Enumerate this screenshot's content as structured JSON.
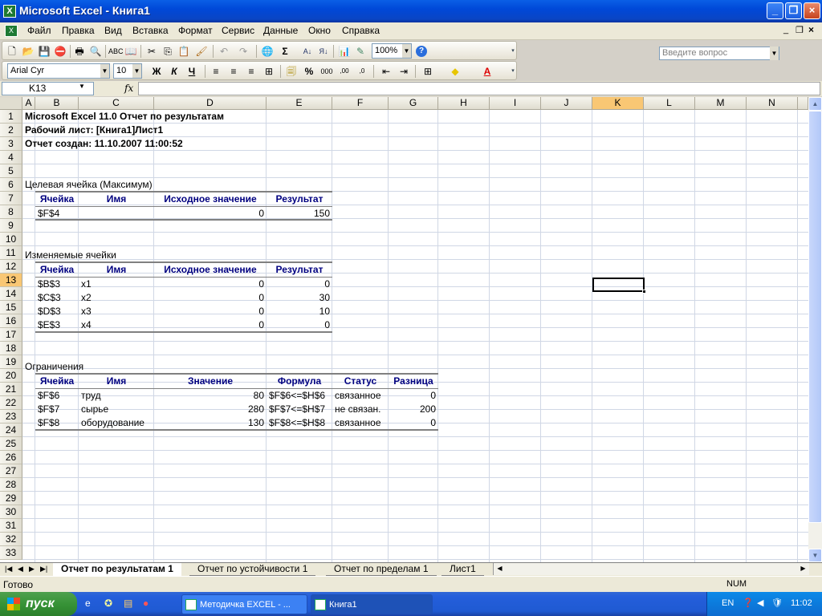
{
  "window": {
    "title": "Microsoft Excel - Книга1",
    "app_icon": "excel-icon"
  },
  "menu": {
    "items": [
      "Файл",
      "Правка",
      "Вид",
      "Вставка",
      "Формат",
      "Сервис",
      "Данные",
      "Окно",
      "Справка"
    ],
    "ask_placeholder": "Введите вопрос"
  },
  "toolbar": {
    "zoom": "100%",
    "font": "Arial Cyr",
    "size": "10"
  },
  "formula_bar": {
    "name_box": "K13",
    "fx_label": "fx",
    "content": ""
  },
  "columns": [
    "A",
    "B",
    "C",
    "D",
    "E",
    "F",
    "G",
    "H",
    "I",
    "J",
    "K",
    "L",
    "M",
    "N"
  ],
  "rows": [
    "1",
    "2",
    "3",
    "4",
    "5",
    "6",
    "7",
    "8",
    "9",
    "10",
    "11",
    "12",
    "13",
    "14",
    "15",
    "16",
    "17",
    "18",
    "19",
    "20",
    "21",
    "22",
    "23",
    "24",
    "25",
    "26",
    "27",
    "28",
    "29",
    "30",
    "31",
    "32",
    "33"
  ],
  "report": {
    "line1": "Microsoft Excel 11.0 Отчет по результатам",
    "line2": "Рабочий лист: [Книга1]Лист1",
    "line3": "Отчет создан: 11.10.2007 11:00:52",
    "target_title": "Целевая ячейка (Максимум)",
    "target_headers": [
      "Ячейка",
      "Имя",
      "Исходное значение",
      "Результат"
    ],
    "target_row": {
      "cell": "$F$4",
      "name": "",
      "initial": "0",
      "result": "150"
    },
    "vars_title": "Изменяемые ячейки",
    "vars_headers": [
      "Ячейка",
      "Имя",
      "Исходное значение",
      "Результат"
    ],
    "vars_rows": [
      {
        "cell": "$B$3",
        "name": "x1",
        "initial": "0",
        "result": "0"
      },
      {
        "cell": "$C$3",
        "name": "x2",
        "initial": "0",
        "result": "30"
      },
      {
        "cell": "$D$3",
        "name": "x3",
        "initial": "0",
        "result": "10"
      },
      {
        "cell": "$E$3",
        "name": "x4",
        "initial": "0",
        "result": "0"
      }
    ],
    "constr_title": "Ограничения",
    "constr_headers": [
      "Ячейка",
      "Имя",
      "Значение",
      "Формула",
      "Статус",
      "Разница"
    ],
    "constr_rows": [
      {
        "cell": "$F$6",
        "name": "труд",
        "value": "80",
        "formula": "$F$6<=$H$6",
        "status": "связанное",
        "diff": "0"
      },
      {
        "cell": "$F$7",
        "name": "сырье",
        "value": "280",
        "formula": "$F$7<=$H$7",
        "status": "не связан.",
        "diff": "200"
      },
      {
        "cell": "$F$8",
        "name": "оборудование",
        "value": "130",
        "formula": "$F$8<=$H$8",
        "status": "связанное",
        "diff": "0"
      }
    ]
  },
  "sheet_tabs": [
    "Отчет по результатам 1",
    "Отчет по устойчивости 1",
    "Отчет по пределам 1",
    "Лист1"
  ],
  "status": {
    "left": "Готово",
    "num": "NUM"
  },
  "taskbar": {
    "start": "пуск",
    "tasks": [
      "Методичка EXCEL - ...",
      "Книга1"
    ],
    "lang": "EN",
    "time": "11:02"
  }
}
